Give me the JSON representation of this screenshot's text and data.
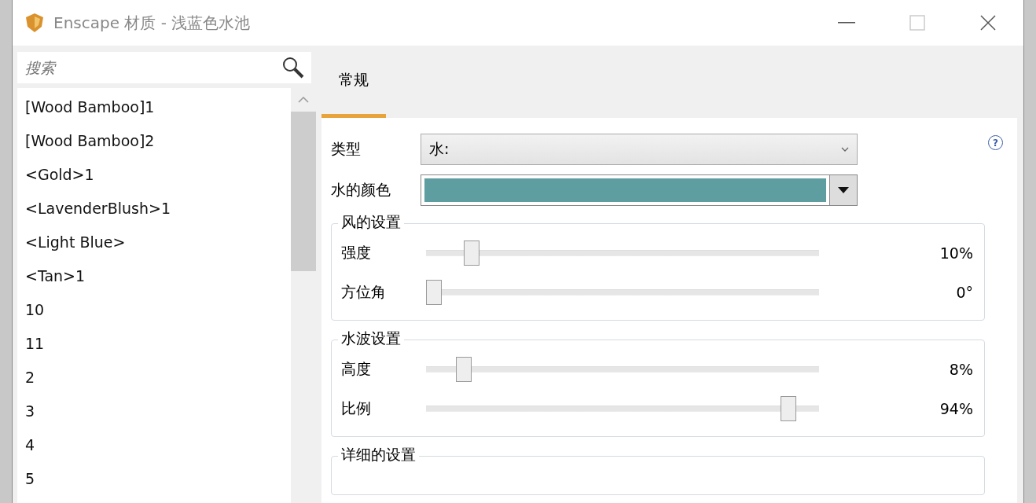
{
  "window": {
    "title": "Enscape 材质 - 浅蓝色水池"
  },
  "search": {
    "placeholder": "搜索"
  },
  "materials": [
    {
      "name": "[Wood Bamboo]1"
    },
    {
      "name": "[Wood Bamboo]2"
    },
    {
      "name": "<Gold>1"
    },
    {
      "name": "<LavenderBlush>1"
    },
    {
      "name": "<Light Blue>"
    },
    {
      "name": "<Tan>1"
    },
    {
      "name": "10"
    },
    {
      "name": "11"
    },
    {
      "name": "2"
    },
    {
      "name": "3"
    },
    {
      "name": "4"
    },
    {
      "name": "5"
    }
  ],
  "tabs": [
    {
      "label": "常规",
      "selected": true
    }
  ],
  "type_field": {
    "label": "类型",
    "value": "水:"
  },
  "water_color": {
    "label": "水的颜色",
    "color": "#5f9ea0"
  },
  "groups": [
    {
      "title": "风的设置",
      "sliders": [
        {
          "label": "强度",
          "level": 0.1,
          "reading": "10%"
        },
        {
          "label": "方位角",
          "level": 0,
          "reading": "0°"
        }
      ]
    },
    {
      "title": "水波设置",
      "sliders": [
        {
          "label": "高度",
          "level": 0.08,
          "reading": "8%"
        },
        {
          "label": "比例",
          "level": 0.94,
          "reading": "94%"
        }
      ]
    },
    {
      "title": "详细的设置"
    }
  ],
  "help": {
    "icon": "?"
  }
}
